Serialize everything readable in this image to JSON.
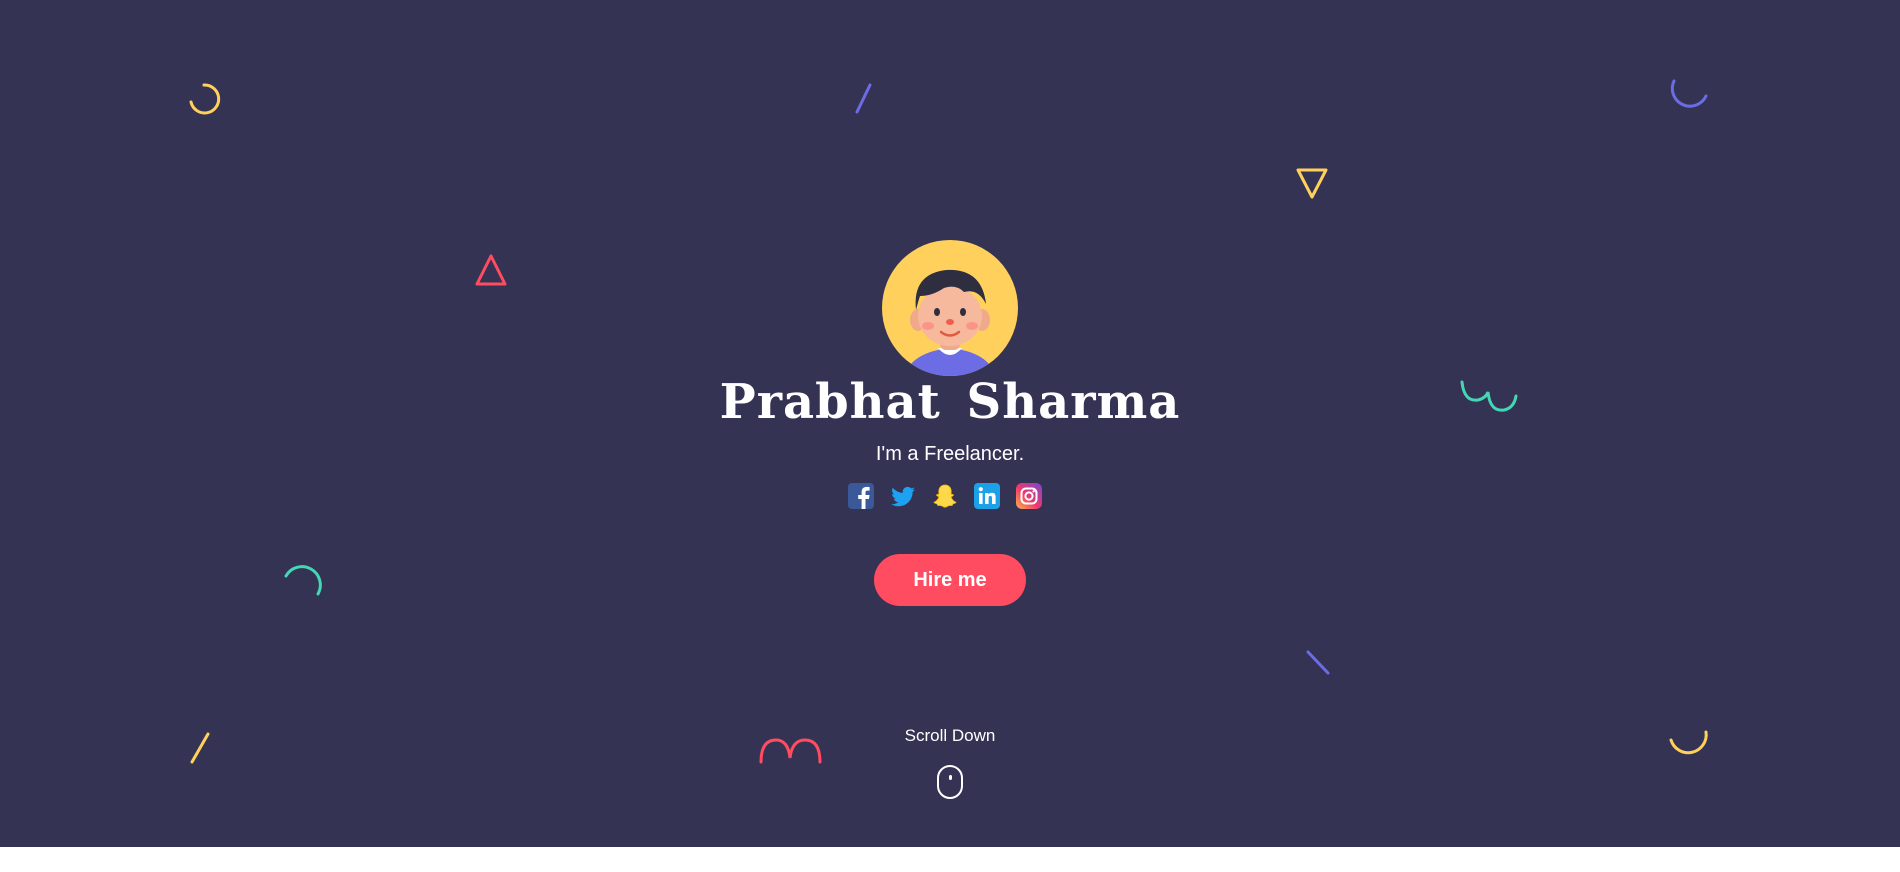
{
  "hero": {
    "name": "Prabhat Sharma",
    "tagline": "I'm a Freelancer.",
    "hire_button_label": "Hire me",
    "scroll_label": "Scroll Down"
  },
  "social_links": [
    {
      "icon": "facebook-icon",
      "color": "#3b5998"
    },
    {
      "icon": "twitter-icon",
      "color": "#1da1f2"
    },
    {
      "icon": "snapchat-icon",
      "color": "#fffc00"
    },
    {
      "icon": "linkedin-icon",
      "color": "#0e76a8"
    },
    {
      "icon": "instagram-icon",
      "color": "#e1306c"
    }
  ],
  "colors": {
    "background": "#353353",
    "accent": "#ff4c60",
    "avatar_bg": "#ffd15c",
    "deco_yellow": "#ffd15c",
    "deco_purple": "#6c6ce5",
    "deco_teal": "#44d7b6",
    "deco_red": "#ff4c60"
  }
}
